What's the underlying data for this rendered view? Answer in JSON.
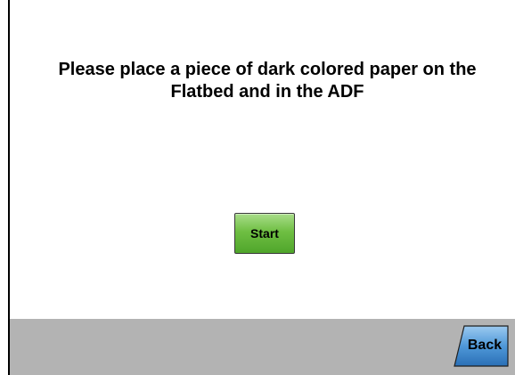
{
  "dialog": {
    "message": "Please place a piece of dark colored paper on the Flatbed and in the ADF",
    "start_label": "Start"
  },
  "footer": {
    "back_label": "Back"
  },
  "colors": {
    "start_button": "#6fbf43",
    "back_button": "#2f7cc4",
    "footer_bar": "#b3b3b3"
  }
}
